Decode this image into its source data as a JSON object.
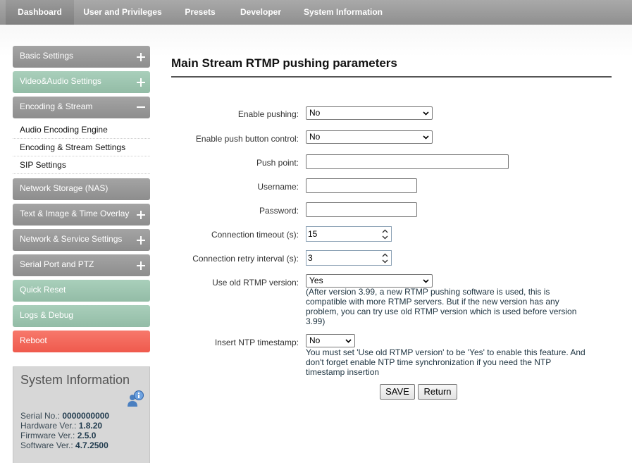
{
  "nav": {
    "tabs": [
      "Dashboard",
      "User and Privileges",
      "Presets",
      "Developer",
      "System Information"
    ],
    "active": "Dashboard"
  },
  "sidebar": {
    "menus": [
      {
        "label": "Basic Settings",
        "state": "plus"
      },
      {
        "label": "Video&Audio Settings",
        "state": "plus"
      },
      {
        "label": "Encoding & Stream",
        "state": "minus"
      },
      {
        "label": "Network Storage (NAS)",
        "state": "none"
      },
      {
        "label": "Text & Image & Time Overlay",
        "state": "plus"
      },
      {
        "label": "Network & Service Settings",
        "state": "plus"
      },
      {
        "label": "Serial Port and PTZ",
        "state": "plus"
      },
      {
        "label": "Quick Reset",
        "state": "none"
      },
      {
        "label": "Logs & Debug",
        "state": "none"
      },
      {
        "label": "Reboot",
        "state": "none"
      }
    ],
    "submenu": [
      "Audio Encoding Engine",
      "Encoding & Stream Settings",
      "SIP Settings"
    ]
  },
  "system_info": {
    "title": "System Information",
    "serial_label": "Serial No.: ",
    "serial": "0000000000",
    "hardware_label": "Hardware Ver.: ",
    "hardware": "1.8.20",
    "firmware_label": "Firmware Ver.: ",
    "firmware": "2.5.0",
    "software_label": "Software Ver.: ",
    "software": "4.7.2500"
  },
  "main": {
    "title": "Main Stream RTMP pushing parameters",
    "fields": {
      "enable_pushing": {
        "label": "Enable pushing:",
        "value": "No"
      },
      "enable_push_button": {
        "label": "Enable push button control:",
        "value": "No"
      },
      "push_point": {
        "label": "Push point:",
        "value": ""
      },
      "username": {
        "label": "Username:",
        "value": ""
      },
      "password": {
        "label": "Password:",
        "value": ""
      },
      "connection_timeout": {
        "label": "Connection timeout (s):",
        "value": "15"
      },
      "connection_retry": {
        "label": "Connection retry interval (s):",
        "value": "3"
      },
      "old_rtmp": {
        "label": "Use old RTMP version:",
        "value": "Yes",
        "note": "(After version 3.99, a new RTMP pushing software is used, this is compatible with more RTMP servers. But if the new version has any problem, you can try use old RTMP version which is used before version 3.99)"
      },
      "ntp_timestamp": {
        "label": "Insert NTP timestamp:",
        "value": "No",
        "note": "You must set 'Use old RTMP version' to be 'Yes' to enable this feature. And don't forget enable NTP time synchronization if you need the NTP timestamp insertion"
      }
    },
    "buttons": {
      "save": "SAVE",
      "return": "Return"
    }
  }
}
